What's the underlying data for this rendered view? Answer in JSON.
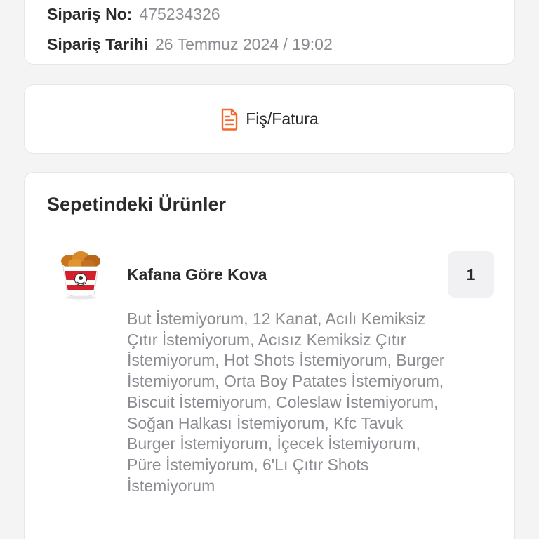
{
  "order": {
    "number_label": "Sipariş No:",
    "number_value": "475234326",
    "date_label": "Sipariş Tarihi",
    "date_value": "26 Temmuz 2024 / 19:02"
  },
  "receipt": {
    "label": "Fiş/Fatura",
    "icon": "document-icon",
    "accent_color": "#f26a2d"
  },
  "basket": {
    "title": "Sepetindeki Ürünler",
    "items": [
      {
        "name": "Kafana Göre Kova",
        "quantity": "1",
        "image": "kfc-bucket-image",
        "options": "But İstemiyorum, 12 Kanat, Acılı Kemiksiz Çıtır İstemiyorum, Acısız Kemiksiz Çıtır İstemiyorum, Hot Shots İstemiyorum, Burger İstemiyorum, Orta Boy Patates İstemiyorum, Biscuit İstemiyorum, Coleslaw İstemiyorum, Soğan Halkası İstemiyorum, Kfc Tavuk Burger İstemiyorum, İçecek İstemiyorum, Püre İstemiyorum, 6'Lı Çıtır Shots İstemiyorum"
      }
    ]
  }
}
